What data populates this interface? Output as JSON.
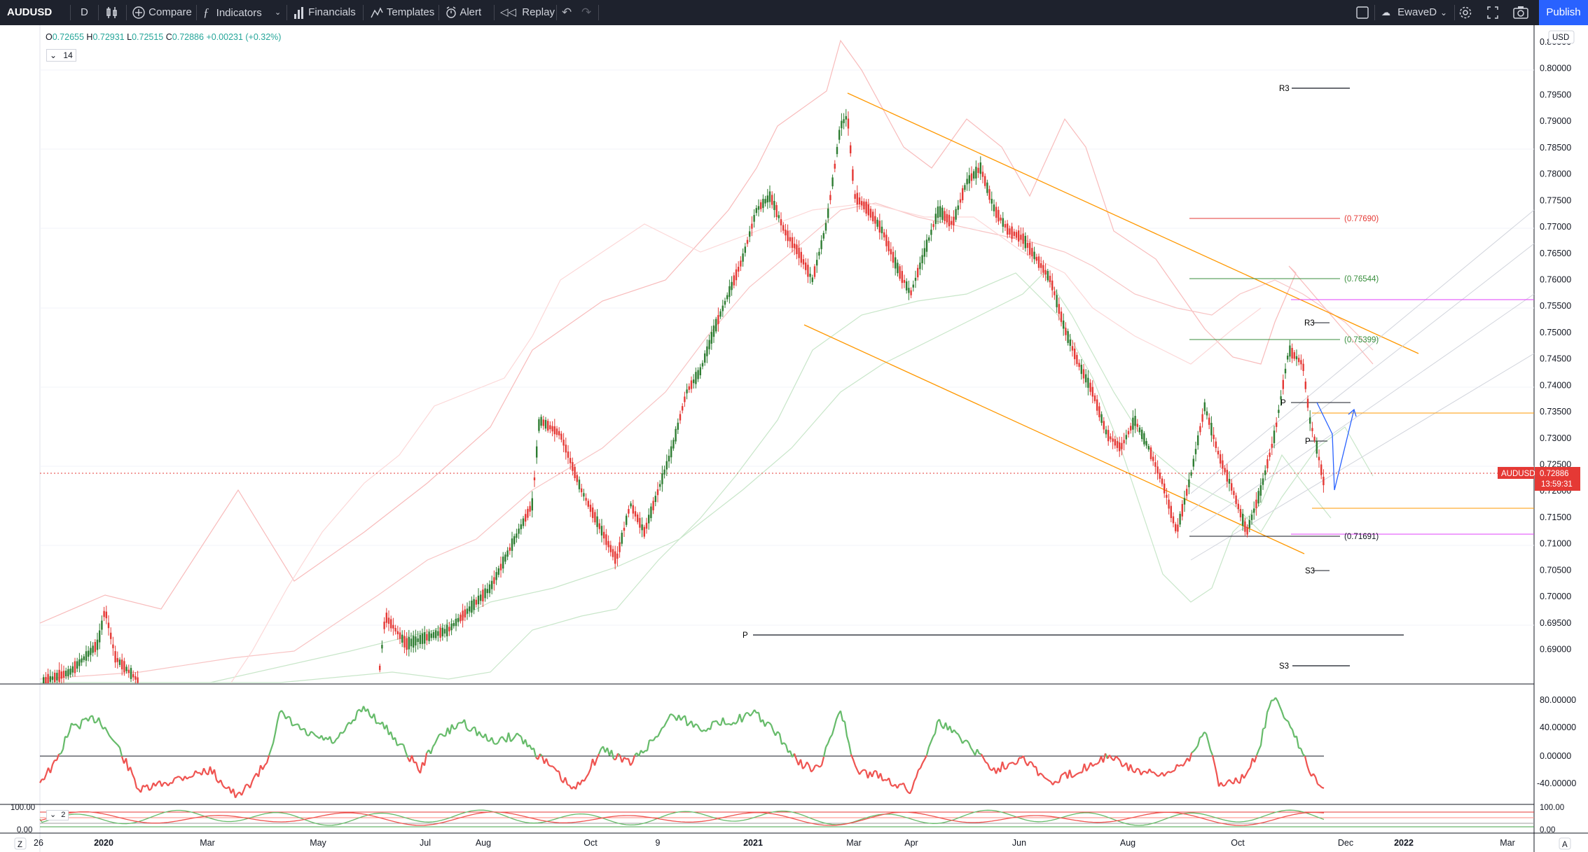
{
  "toolbar": {
    "symbol": "AUDUSD",
    "interval": "D",
    "compare": "Compare",
    "indicators": "Indicators",
    "financials": "Financials",
    "templates": "Templates",
    "alert": "Alert",
    "replay": "Replay",
    "layout_name": "EwaveD",
    "publish": "Publish"
  },
  "legend": {
    "open_label": "O",
    "open": "0.72655",
    "high_label": "H",
    "high": "0.72931",
    "low_label": "L",
    "low": "0.72515",
    "close_label": "C",
    "close": "0.72886",
    "change": "+0.00231 (+0.32%)",
    "indicator_param": "14",
    "pane3_param": "2"
  },
  "price_axis": {
    "currency": "USD",
    "ticks": [
      "0.80500",
      "0.80000",
      "0.79500",
      "0.79000",
      "0.78500",
      "0.78000",
      "0.77500",
      "0.77000",
      "0.76500",
      "0.76000",
      "0.75500",
      "0.75000",
      "0.74500",
      "0.74000",
      "0.73500",
      "0.73000",
      "0.72500",
      "0.72000",
      "0.71500",
      "0.71000",
      "0.70500",
      "0.70000",
      "0.69500",
      "0.69000"
    ],
    "current_symbol": "AUDUSD",
    "current_price": "0.72886",
    "countdown": "13:59:31"
  },
  "osc_axis": {
    "ticks": [
      "80.00000",
      "40.00000",
      "0.00000",
      "-40.00000"
    ]
  },
  "stoch_axis": {
    "left": [
      "100.00",
      "0.00"
    ],
    "right": [
      "100.00",
      "0.00"
    ]
  },
  "time_axis": {
    "labels": [
      "26",
      "2020",
      "Mar",
      "May",
      "Jul",
      "Aug",
      "Oct",
      "9",
      "2021",
      "Mar",
      "Apr",
      "Jun",
      "Aug",
      "Oct",
      "Dec",
      "2022",
      "Mar"
    ],
    "left_btn": "Z",
    "right_btn": "A"
  },
  "annotations": {
    "r3_top": "R3",
    "p_main": "P",
    "s3_main": "S3",
    "r3_small": "R3",
    "p_small": "P",
    "p_small2": "P",
    "s3_small": "S3",
    "fib1": "(0.77690)",
    "fib2": "(0.76544)",
    "fib3": "(0.75399)",
    "fib4": "(0.71691)"
  },
  "colors": {
    "up": "#26a69a",
    "candle_up": "#2e7d32",
    "candle_down": "#e53935",
    "accent": "#2962ff",
    "channel": "#ff9800",
    "pivot_magenta": "#e040fb"
  },
  "chart_data": {
    "type": "candlestick",
    "symbol": "AUDUSD",
    "interval": "D",
    "ylim": [
      0.69,
      0.806
    ],
    "key_prices": {
      "open": 0.72655,
      "high": 0.72931,
      "low": 0.72515,
      "close": 0.72886
    },
    "levels": [
      0.7769,
      0.76544,
      0.75399,
      0.71691
    ]
  }
}
